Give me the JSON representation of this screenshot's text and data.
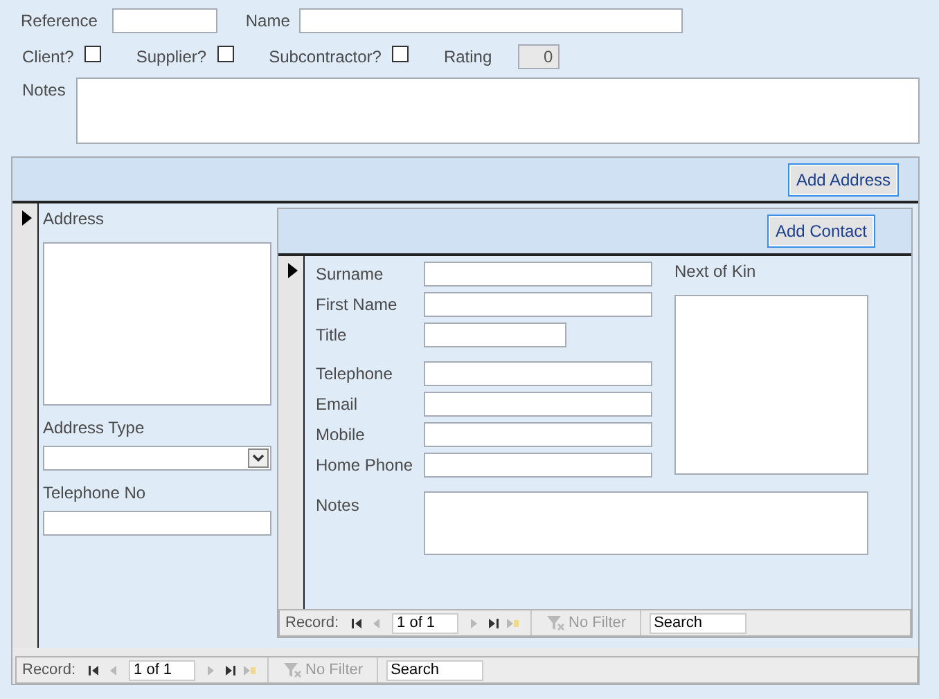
{
  "header": {
    "reference": {
      "label": "Reference"
    },
    "name": {
      "label": "Name"
    },
    "checkboxes": [
      {
        "label": "Client?",
        "checked": false
      },
      {
        "label": "Supplier?",
        "checked": false
      },
      {
        "label": "Subcontractor?",
        "checked": false
      }
    ],
    "rating": {
      "label": "Rating",
      "value": "0"
    },
    "notes": {
      "label": "Notes"
    }
  },
  "address_subform": {
    "button": "Add Address",
    "address": {
      "label": "Address"
    },
    "address_type": {
      "label": "Address Type"
    },
    "telephone": {
      "label": "Telephone No"
    },
    "contact_subform": {
      "button": "Add Contact",
      "name_fields": [
        {
          "label": "Surname",
          "kind": "long"
        },
        {
          "label": "First Name",
          "kind": "long"
        },
        {
          "label": "Title",
          "kind": "short"
        }
      ],
      "phone_fields": [
        {
          "label": "Telephone"
        },
        {
          "label": "Email"
        },
        {
          "label": "Mobile"
        },
        {
          "label": "Home Phone"
        }
      ],
      "next_of_kin": {
        "label": "Next of Kin"
      },
      "notes": {
        "label": "Notes"
      },
      "navigation": {
        "label": "Record:",
        "buttons": [
          {
            "kind": "first",
            "disabled": false
          },
          {
            "kind": "previous",
            "disabled": true
          },
          {
            "kind": "next",
            "disabled": true
          },
          {
            "kind": "last",
            "disabled": false
          },
          {
            "kind": "new",
            "disabled": true
          }
        ],
        "position": "1 of 1",
        "filter": {
          "label": "No Filter",
          "disabled": true
        },
        "search": {
          "placeholder": "Search"
        }
      }
    },
    "navigation": {
      "label": "Record:",
      "buttons": [
        {
          "kind": "first",
          "disabled": false
        },
        {
          "kind": "previous",
          "disabled": true
        },
        {
          "kind": "next",
          "disabled": true
        },
        {
          "kind": "last",
          "disabled": false
        },
        {
          "kind": "new",
          "disabled": true
        }
      ],
      "position": "1 of 1",
      "filter": {
        "label": "No Filter",
        "disabled": true
      },
      "search": {
        "placeholder": "Search"
      }
    }
  }
}
